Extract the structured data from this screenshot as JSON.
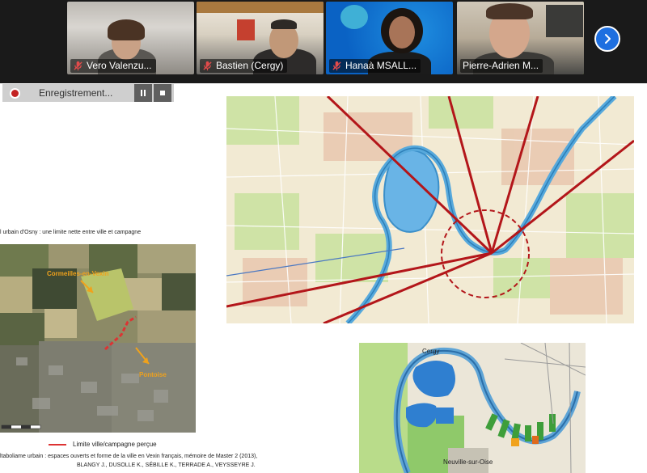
{
  "participants": [
    {
      "name": "Vero Valenzu...",
      "muted": true,
      "active": false
    },
    {
      "name": "Bastien (Cergy)",
      "muted": true,
      "active": false
    },
    {
      "name": "Hanaà MSALL...",
      "muted": true,
      "active": false
    },
    {
      "name": "Pierre-Adrien M...",
      "muted": false,
      "active": true
    }
  ],
  "recording": {
    "label": "Enregistrement..."
  },
  "icons": {
    "next": "chevron-right-icon",
    "mic_muted": "mic-off-icon",
    "pause": "pause-icon",
    "stop": "stop-icon",
    "record": "record-dot-icon"
  },
  "colors": {
    "strip_bg": "#1a1a1a",
    "active_border": "#9ad14b",
    "next_button": "#1e6fe0",
    "record_red": "#c32222",
    "map_red_line": "#b3161a"
  },
  "slide": {
    "caption_top": "l urbain d'Osny : une limite nette entre ville et campagne",
    "aerial_labels": {
      "north": "Cormeilles-en-Vexin",
      "south": "Pontoise"
    },
    "legend_label": "Limite ville/campagne perçue",
    "source_line1": "ltaboliame urbain : espaces ouverts et forme de la ville en Vexin français, mémoire de Master 2 (2013),",
    "source_line2": "BLANGY J., DUSOLLE K., SÉBILLE K., TERRADE A., VEYSSEYRE J.",
    "bottom_map_labels": {
      "top": "Cergy",
      "bottom": "Neuville-sur-Oise"
    }
  }
}
